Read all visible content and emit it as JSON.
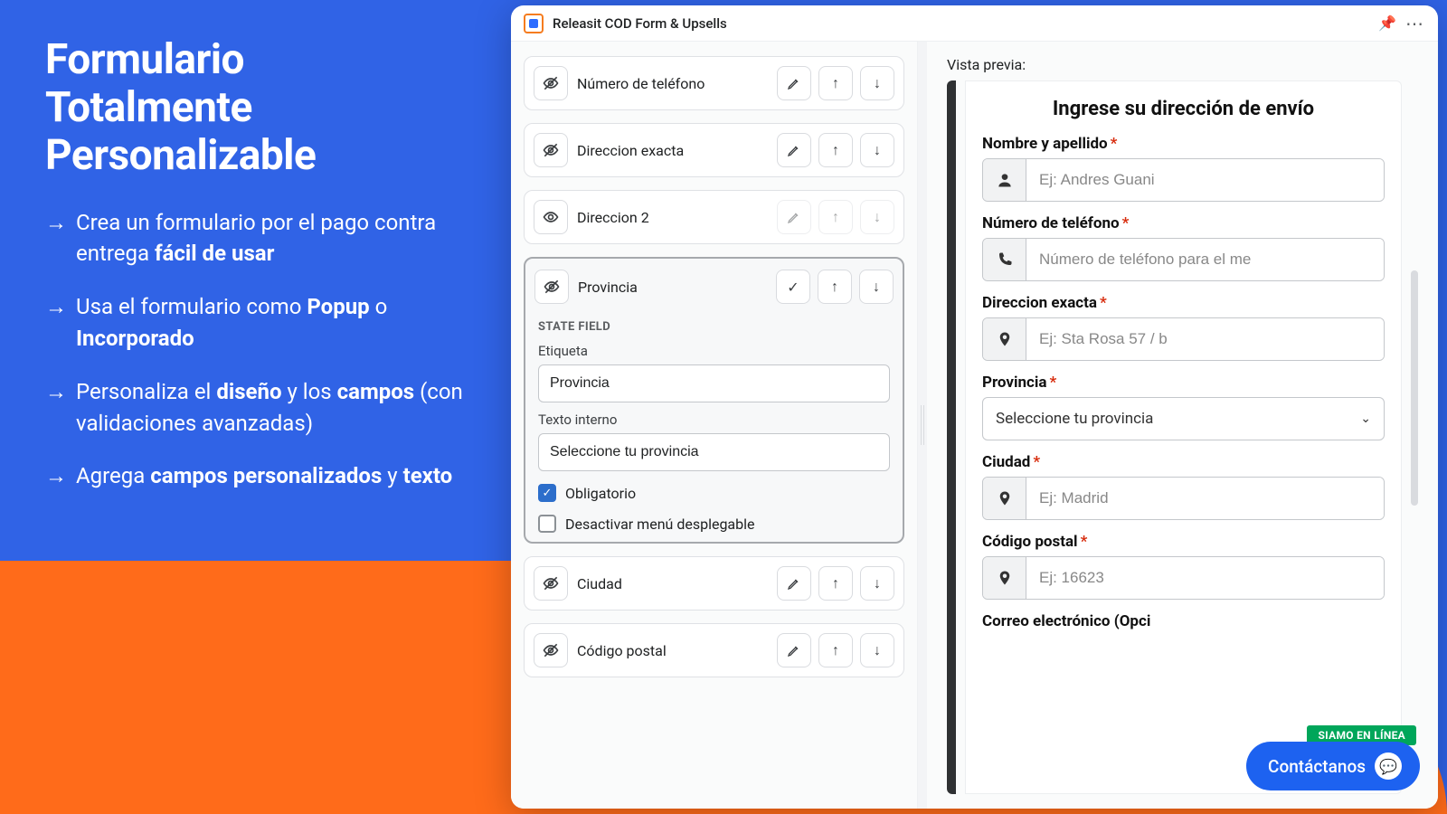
{
  "hero": {
    "title_l1": "Formulario",
    "title_l2": "Totalmente",
    "title_l3": "Personalizable",
    "b1_pre": "Crea un formulario por el pago contra entrega ",
    "b1_bold": "fácil de usar",
    "b2_pre": "Usa el formulario como ",
    "b2_bold1": "Popup",
    "b2_mid": " o ",
    "b2_bold2": "Incorporado",
    "b3_pre": "Personaliza el ",
    "b3_bold1": "diseño",
    "b3_mid": " y los ",
    "b3_bold2": "campos",
    "b3_post": " (con validaciones avanzadas)",
    "b4_pre": "Agrega ",
    "b4_bold1": "campos personalizados",
    "b4_mid": " y ",
    "b4_bold2": "texto"
  },
  "app": {
    "title": "Releasit COD Form & Upsells"
  },
  "builder": {
    "rows": [
      {
        "label": "Número de teléfono",
        "hidden": true
      },
      {
        "label": "Direccion exacta",
        "hidden": true
      },
      {
        "label": "Direccion 2",
        "hidden": false
      }
    ],
    "expanded": {
      "label": "Provincia",
      "section_title": "STATE FIELD",
      "etiqueta_label": "Etiqueta",
      "etiqueta_value": "Provincia",
      "texto_label": "Texto interno",
      "texto_value": "Seleccione tu provincia",
      "obligatorio_label": "Obligatorio",
      "desactivar_label": "Desactivar menú desplegable"
    },
    "rows_after": [
      {
        "label": "Ciudad",
        "hidden": true
      },
      {
        "label": "Código postal",
        "hidden": true
      }
    ]
  },
  "preview": {
    "heading": "Vista previa:",
    "form_title": "Ingrese su dirección de envío",
    "fields": {
      "name_label": "Nombre y apellido",
      "name_ph": "Ej: Andres Guani",
      "phone_label": "Número de teléfono",
      "phone_ph": "Número de teléfono para el me",
      "addr_label": "Direccion exacta",
      "addr_ph": "Ej: Sta Rosa 57 / b",
      "prov_label": "Provincia",
      "prov_selected": "Seleccione tu provincia",
      "city_label": "Ciudad",
      "city_ph": "Ej: Madrid",
      "postal_label": "Código postal",
      "postal_ph": "Ej: 16623",
      "email_label": "Correo electrónico (Opci"
    }
  },
  "chat": {
    "online": "SIAMO EN LÍNEA",
    "label": "Contáctanos"
  }
}
